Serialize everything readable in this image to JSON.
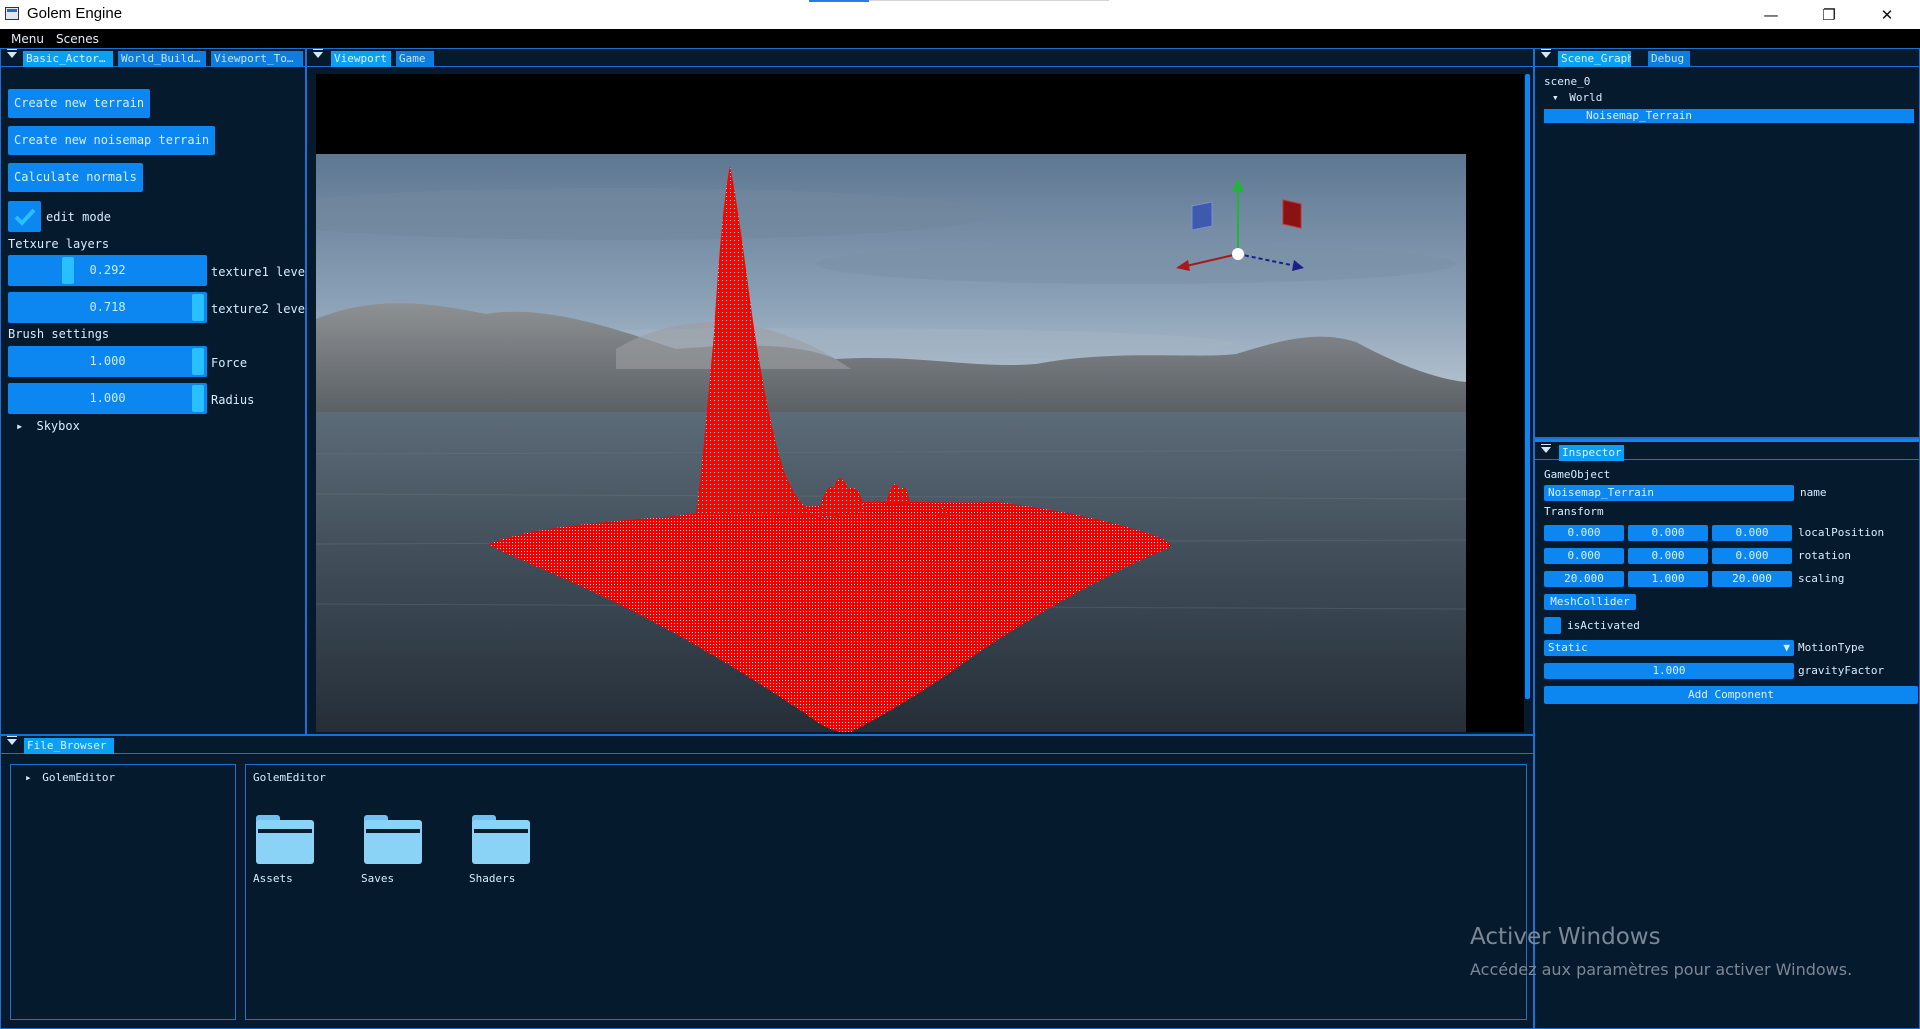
{
  "window": {
    "title": "Golem Engine",
    "controls": {
      "minimize": "—",
      "maximize": "❐",
      "close": "✕"
    }
  },
  "menubar": {
    "items": [
      "Menu",
      "Scenes"
    ]
  },
  "left_panel": {
    "tabs": [
      "Basic_Actor…",
      "World_Build…",
      "Viewport_To…"
    ],
    "buttons": {
      "create_terrain": "Create new terrain",
      "create_noisemap": "Create new noisemap terrain",
      "calc_normals": "Calculate normals"
    },
    "edit_mode": {
      "label": "edit mode",
      "checked": true
    },
    "texture_layers": {
      "heading": "Tetxure layers",
      "texture1": {
        "value": "0.292",
        "level": 0.292,
        "label": "texture1 leve"
      },
      "texture2": {
        "value": "0.718",
        "level": 1.0,
        "label": "texture2 leve"
      }
    },
    "brush": {
      "heading": "Brush settings",
      "force": {
        "value": "1.000",
        "label": "Force"
      },
      "radius": {
        "value": "1.000",
        "label": "Radius"
      }
    },
    "skybox": "Skybox"
  },
  "viewport_panel": {
    "tabs": [
      "Viewport",
      "Game"
    ]
  },
  "scene_graph": {
    "tabs": [
      "Scene_Graph",
      "Debug"
    ],
    "root": "scene_0",
    "world": "World",
    "selected": "Noisemap_Terrain"
  },
  "inspector": {
    "tab": "Inspector",
    "gameobject_heading": "GameObject",
    "name_value": "Noisemap_Terrain",
    "name_label": "name",
    "transform_heading": "Transform",
    "localPosition": {
      "values": [
        "0.000",
        "0.000",
        "0.000"
      ],
      "label": "localPosition"
    },
    "rotation": {
      "values": [
        "0.000",
        "0.000",
        "0.000"
      ],
      "label": "rotation"
    },
    "scaling": {
      "values": [
        "20.000",
        "1.000",
        "20.000"
      ],
      "label": "scaling"
    },
    "mesh_collider": "MeshCollider",
    "is_activated": {
      "label": "isActivated",
      "checked": false
    },
    "motion_type": {
      "value": "Static",
      "label": "MotionType"
    },
    "gravity": {
      "value": "1.000",
      "label": "gravityFactor"
    },
    "add_component": "Add Component"
  },
  "file_browser": {
    "tab": "File_Browser",
    "tree_item": "GolemEditor",
    "path": "GolemEditor",
    "folders": [
      "Assets",
      "Saves",
      "Shaders"
    ]
  },
  "watermark": {
    "title": "Activer Windows",
    "subtitle": "Accédez aux paramètres pour activer Windows."
  },
  "colors": {
    "panel_bg": "#061a2e",
    "accent": "#0c86f0",
    "accent_light": "#0aa0f5",
    "terrain": "#ff0000"
  }
}
